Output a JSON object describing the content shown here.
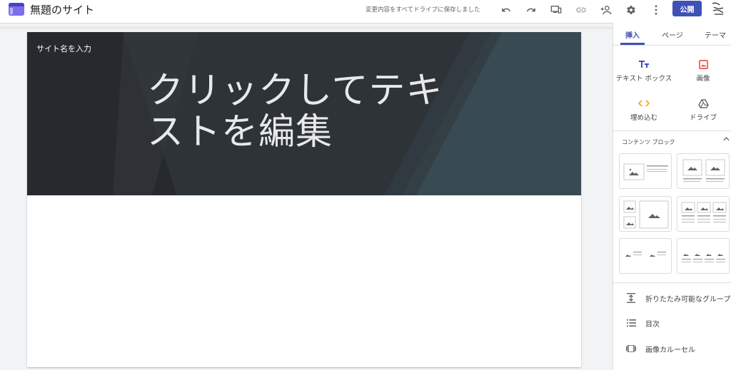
{
  "header": {
    "site_title": "無題のサイト",
    "save_status": "変更内容をすべてドライブに保存しました",
    "publish_label": "公開",
    "icons": [
      "undo-icon",
      "redo-icon",
      "preview-devices-icon",
      "link-icon",
      "add-person-icon",
      "gear-icon",
      "more-vert-icon"
    ]
  },
  "hero": {
    "site_name_placeholder": "サイト名を入力",
    "title_placeholder": "クリックしてテキストを編集"
  },
  "panel": {
    "tabs": [
      {
        "label": "挿入",
        "active": true
      },
      {
        "label": "ページ",
        "active": false
      },
      {
        "label": "テーマ",
        "active": false
      }
    ],
    "insert_items": [
      {
        "label": "テキスト ボックス",
        "icon": "text-box-icon",
        "color": "#3f51b5"
      },
      {
        "label": "画像",
        "icon": "image-icon",
        "color": "#e53935"
      },
      {
        "label": "埋め込む",
        "icon": "embed-icon",
        "color": "#f9a825"
      },
      {
        "label": "ドライブ",
        "icon": "drive-icon",
        "color": "#5f6368"
      }
    ],
    "content_blocks_title": "コンテンツ ブロック",
    "list_items": [
      {
        "label": "折りたたみ可能なグループ",
        "icon": "collapsible-group-icon"
      },
      {
        "label": "目次",
        "icon": "table-of-contents-icon"
      },
      {
        "label": "画像カルーセル",
        "icon": "image-carousel-icon"
      }
    ]
  },
  "colors": {
    "accent": "#3f51b5",
    "hero_background": "#2e3337"
  }
}
